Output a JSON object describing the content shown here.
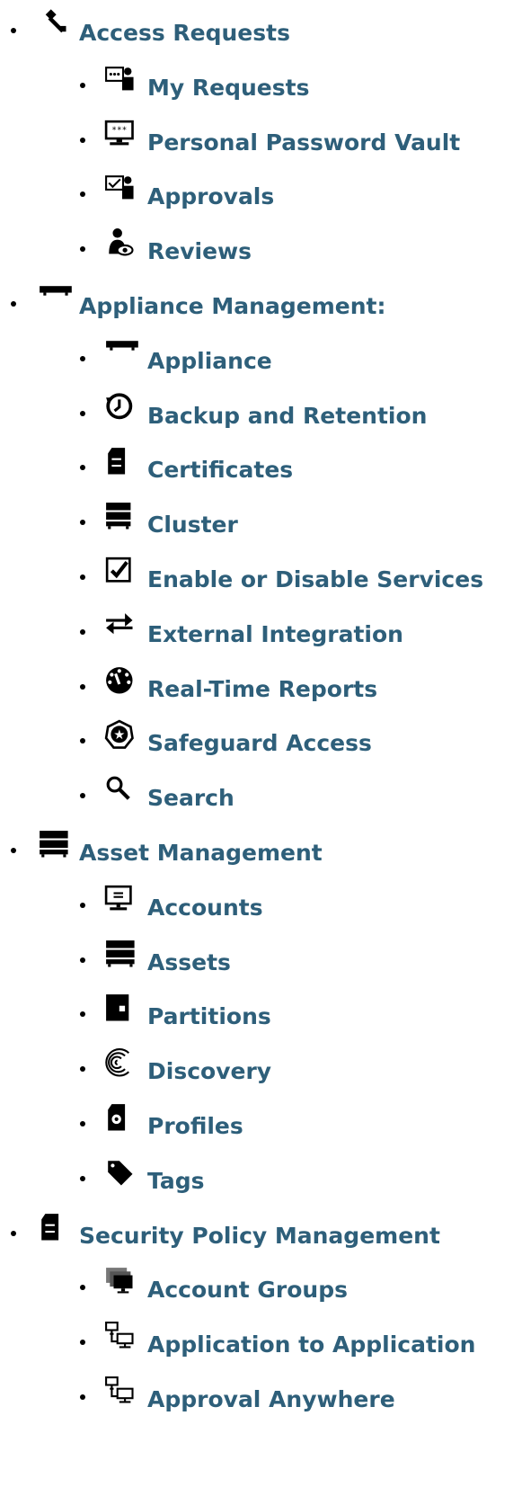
{
  "nav": {
    "sections": [
      {
        "label": "Access Requests",
        "icon": "key-icon",
        "children": [
          {
            "label": "My Requests",
            "icon": "my-requests-icon"
          },
          {
            "label": "Personal Password Vault",
            "icon": "password-vault-icon"
          },
          {
            "label": "Approvals",
            "icon": "approvals-icon"
          },
          {
            "label": "Reviews",
            "icon": "reviews-icon"
          }
        ]
      },
      {
        "label": "Appliance Management:",
        "icon": "appliance-icon",
        "children": [
          {
            "label": "Appliance",
            "icon": "appliance-icon"
          },
          {
            "label": "Backup and Retention",
            "icon": "backup-clock-icon"
          },
          {
            "label": "Certificates",
            "icon": "certificate-icon"
          },
          {
            "label": "Cluster",
            "icon": "cluster-icon"
          },
          {
            "label": "Enable or Disable Services",
            "icon": "checkbox-icon"
          },
          {
            "label": "External Integration",
            "icon": "exchange-arrows-icon"
          },
          {
            "label": "Real-Time Reports",
            "icon": "dashboard-icon"
          },
          {
            "label": "Safeguard Access",
            "icon": "safeguard-star-icon"
          },
          {
            "label": "Search",
            "icon": "search-icon"
          }
        ]
      },
      {
        "label": "Asset Management",
        "icon": "asset-server-icon",
        "children": [
          {
            "label": "Accounts",
            "icon": "accounts-monitor-icon"
          },
          {
            "label": "Assets",
            "icon": "asset-server-icon"
          },
          {
            "label": "Partitions",
            "icon": "partitions-icon"
          },
          {
            "label": "Discovery",
            "icon": "discovery-icon"
          },
          {
            "label": "Profiles",
            "icon": "profile-gear-icon"
          },
          {
            "label": "Tags",
            "icon": "tag-icon"
          }
        ]
      },
      {
        "label": "Security Policy Management",
        "icon": "security-policy-icon",
        "children": [
          {
            "label": "Account Groups",
            "icon": "account-groups-icon"
          },
          {
            "label": "Application to Application",
            "icon": "a2a-network-icon"
          },
          {
            "label": "Approval Anywhere",
            "icon": "approval-anywhere-icon"
          }
        ]
      }
    ]
  },
  "colors": {
    "link": "#2e5f7a",
    "bullet": "#000000",
    "icon": "#000000"
  }
}
